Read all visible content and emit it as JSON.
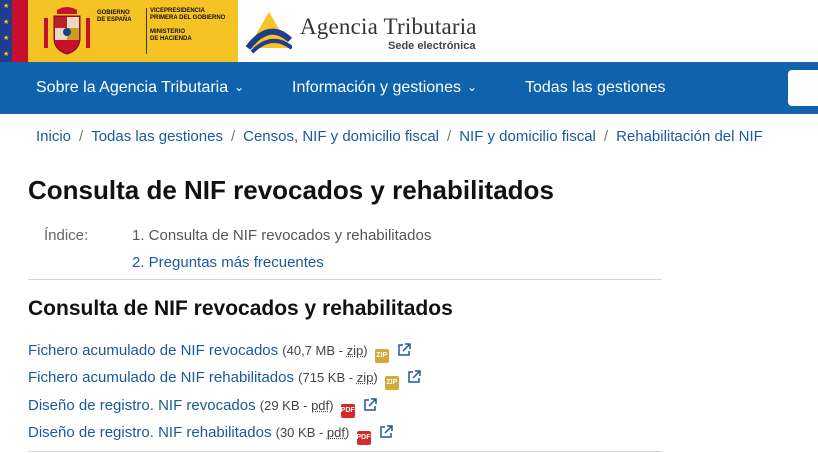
{
  "header": {
    "gov_left_lines": [
      "GOBIERNO",
      "DE ESPAÑA"
    ],
    "gov_right_lines": [
      "VICEPRESIDENCIA",
      "PRIMERA DEL GOBIERNO",
      "",
      "MINISTERIO",
      "DE HACIENDA"
    ],
    "agency_title": "Agencia Tributaria",
    "agency_subtitle": "Sede electrónica"
  },
  "nav": {
    "items": [
      {
        "label": "Sobre la Agencia Tributaria",
        "has_dropdown": true
      },
      {
        "label": "Información y gestiones",
        "has_dropdown": true
      },
      {
        "label": "Todas las gestiones",
        "has_dropdown": false
      }
    ]
  },
  "breadcrumb": [
    "Inicio",
    "Todas las gestiones",
    "Censos, NIF y domicilio fiscal",
    "NIF y domicilio fiscal",
    "Rehabilitación del NIF"
  ],
  "page_title": "Consulta de NIF revocados y rehabilitados",
  "index": {
    "label": "Índice:",
    "items": [
      "1. Consulta de NIF revocados y rehabilitados",
      "2. Preguntas más frecuentes"
    ]
  },
  "section_title": "Consulta de NIF revocados y rehabilitados",
  "files": [
    {
      "label": "Fichero acumulado de NIF revocados",
      "size": "(40,7 MB - ",
      "type": "zip",
      "close": ")"
    },
    {
      "label": "Fichero acumulado de NIF rehabilitados",
      "size": "(715 KB - ",
      "type": "zip",
      "close": ")"
    },
    {
      "label": "Diseño de registro. NIF revocados",
      "size": "(29 KB - ",
      "type": "pdf",
      "close": ")"
    },
    {
      "label": "Diseño de registro. NIF rehabilitados ",
      "size": "(30 KB - ",
      "type": "pdf",
      "close": ")"
    }
  ],
  "colors": {
    "nav_bg": "#0f62ac",
    "link": "#1a5a9a",
    "gov_yellow": "#f6c324"
  }
}
